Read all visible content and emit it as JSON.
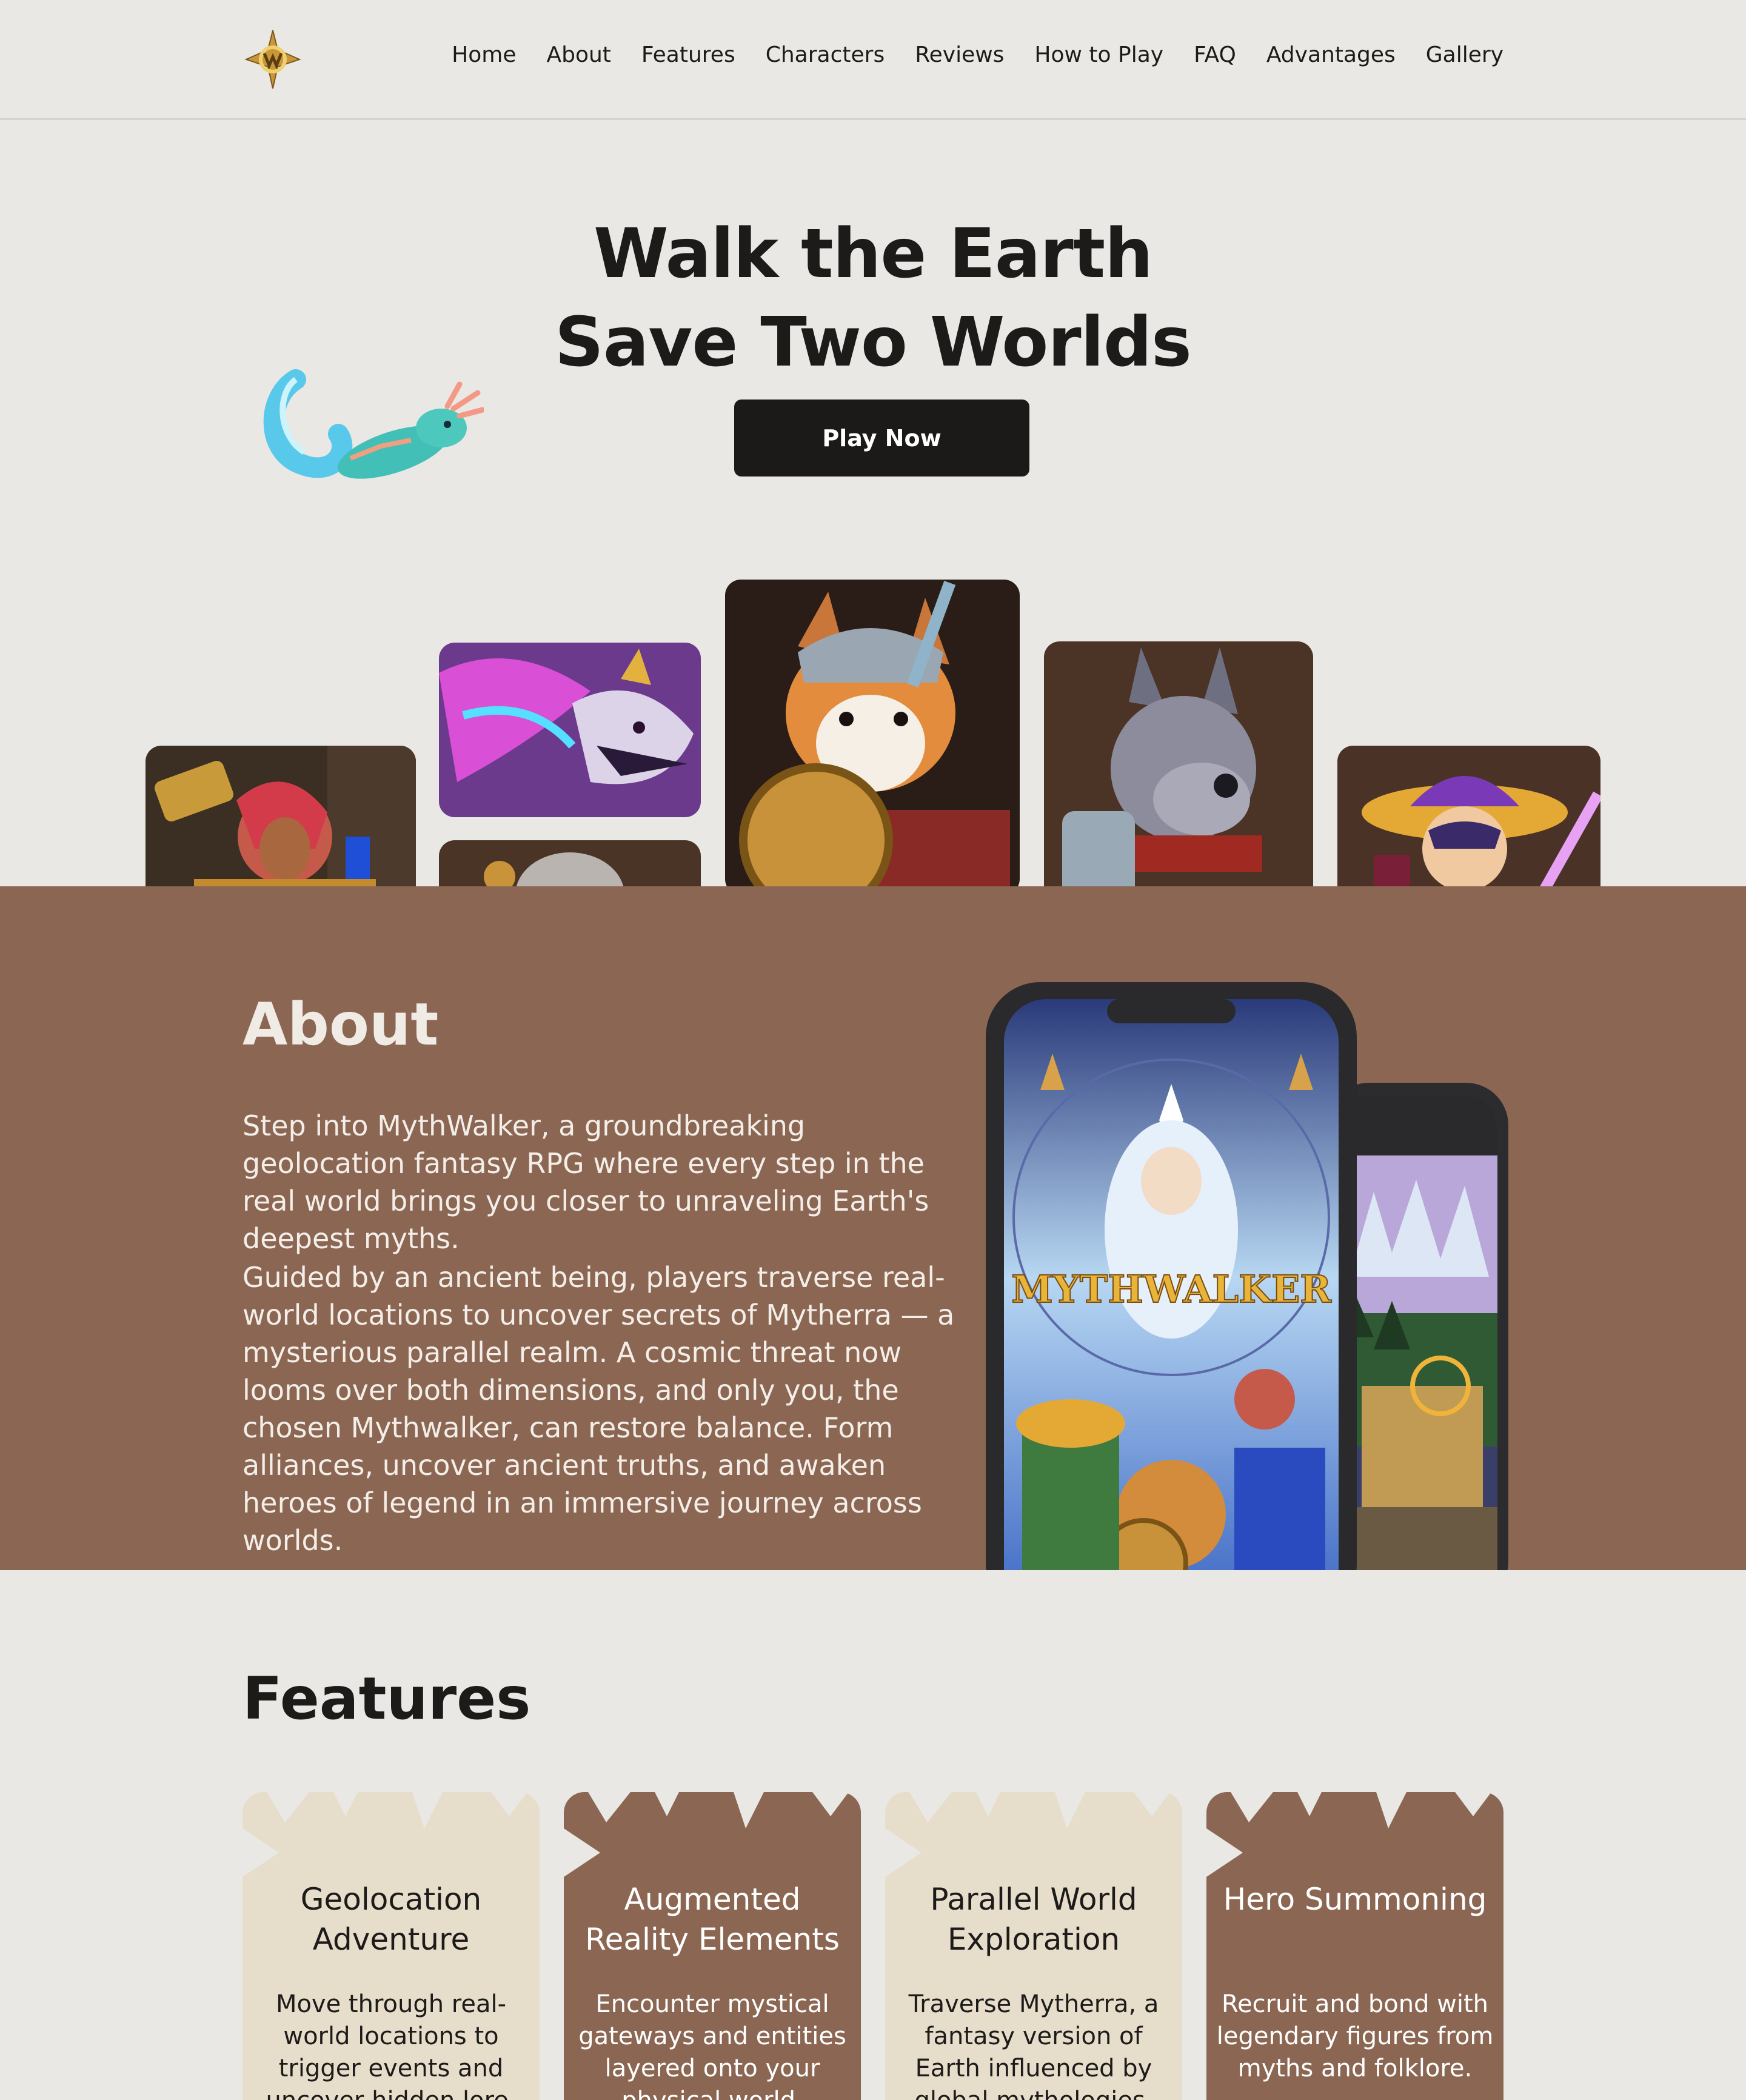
{
  "nav": {
    "items": [
      {
        "label": "Home"
      },
      {
        "label": "About"
      },
      {
        "label": "Features"
      },
      {
        "label": "Characters"
      },
      {
        "label": "Reviews"
      },
      {
        "label": "How to Play"
      },
      {
        "label": "FAQ"
      },
      {
        "label": "Advantages"
      },
      {
        "label": "Gallery"
      }
    ]
  },
  "hero": {
    "title_line1": "Walk the Earth",
    "title_line2": "Save Two Worlds",
    "cta_label": "Play Now"
  },
  "about": {
    "title": "About",
    "paragraph1": "Step into MythWalker, a groundbreaking geolocation fantasy RPG where every step in the real world brings you closer to unraveling Earth's deepest myths.",
    "paragraph2": "Guided by an ancient being, players traverse real-world locations to uncover secrets of Mytherra — a mysterious parallel realm. A cosmic threat now looms over both dimensions, and only you, the chosen Mythwalker, can restore balance. Form alliances, uncover ancient truths, and awaken heroes of legend in an immersive journey across worlds.",
    "phone_logo_text": "MYTHWALKER"
  },
  "features": {
    "title": "Features",
    "cards": [
      {
        "title": "Geolocation Adventure",
        "desc": "Move through real-world locations to trigger events and uncover hidden lore."
      },
      {
        "title": "Augmented Reality Elements",
        "desc": "Encounter mystical gateways and entities layered onto your physical world."
      },
      {
        "title": "Parallel World Exploration",
        "desc": "Traverse Mytherra, a fantasy version of Earth influenced by global mythologies."
      },
      {
        "title": "Hero Summoning",
        "desc": "Recruit and bond with legendary figures from myths and folklore."
      }
    ]
  },
  "colors": {
    "background": "#eae8e5",
    "about_bg": "#8b6753",
    "button_bg": "#1b1a19",
    "feature_light": "#e7ddcb",
    "feature_dark": "#8b6753"
  }
}
